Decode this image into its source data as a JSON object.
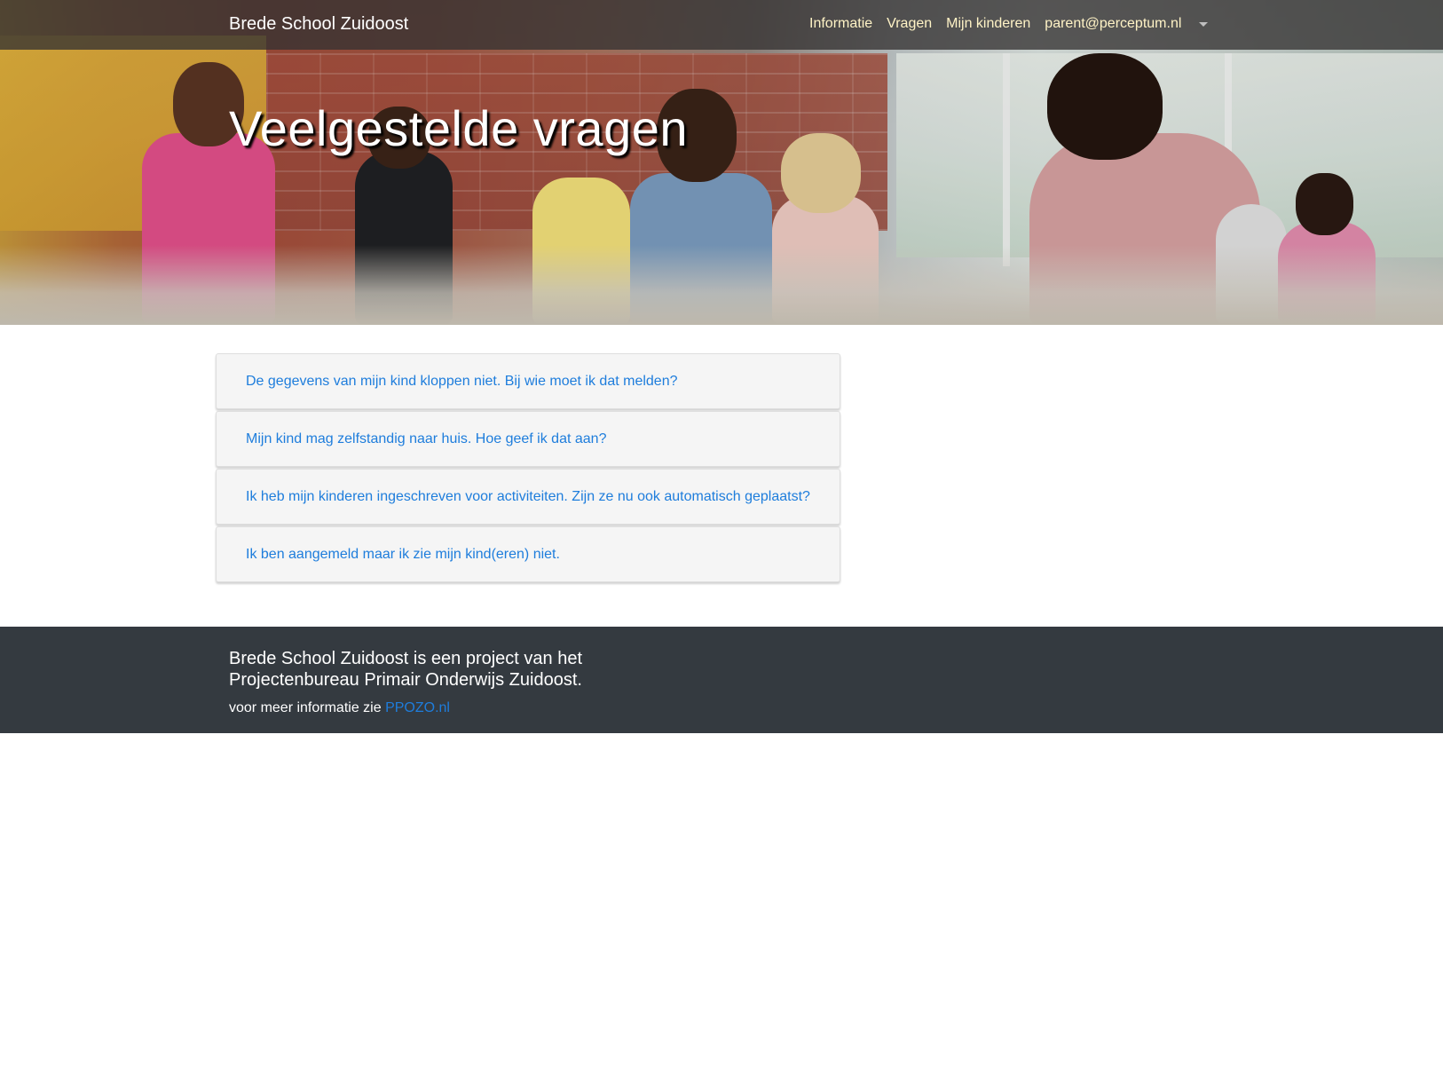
{
  "navbar": {
    "brand": "Brede School Zuidoost",
    "links": [
      "Informatie",
      "Vragen",
      "Mijn kinderen",
      "parent@perceptum.nl"
    ],
    "link_color": "#fff3c6"
  },
  "hero": {
    "title": "Veelgestelde vragen"
  },
  "faq": {
    "items": [
      "De gegevens van mijn kind kloppen niet. Bij wie moet ik dat melden?",
      "Mijn kind mag zelfstandig naar huis. Hoe geef ik dat aan?",
      "Ik heb mijn kinderen ingeschreven voor activiteiten. Zijn ze nu ook automatisch geplaatst?",
      "Ik ben aangemeld maar ik zie mijn kind(eren) niet."
    ],
    "link_color": "#1e7ddc"
  },
  "footer": {
    "title": "Brede School Zuidoost is een project van het Projectenbureau Primair Onderwijs Zuidoost.",
    "more_text": "voor meer informatie zie ",
    "more_link": "PPOZO.nl",
    "background": "#343a40"
  },
  "icons": {
    "dropdown": "caret-down-icon"
  }
}
